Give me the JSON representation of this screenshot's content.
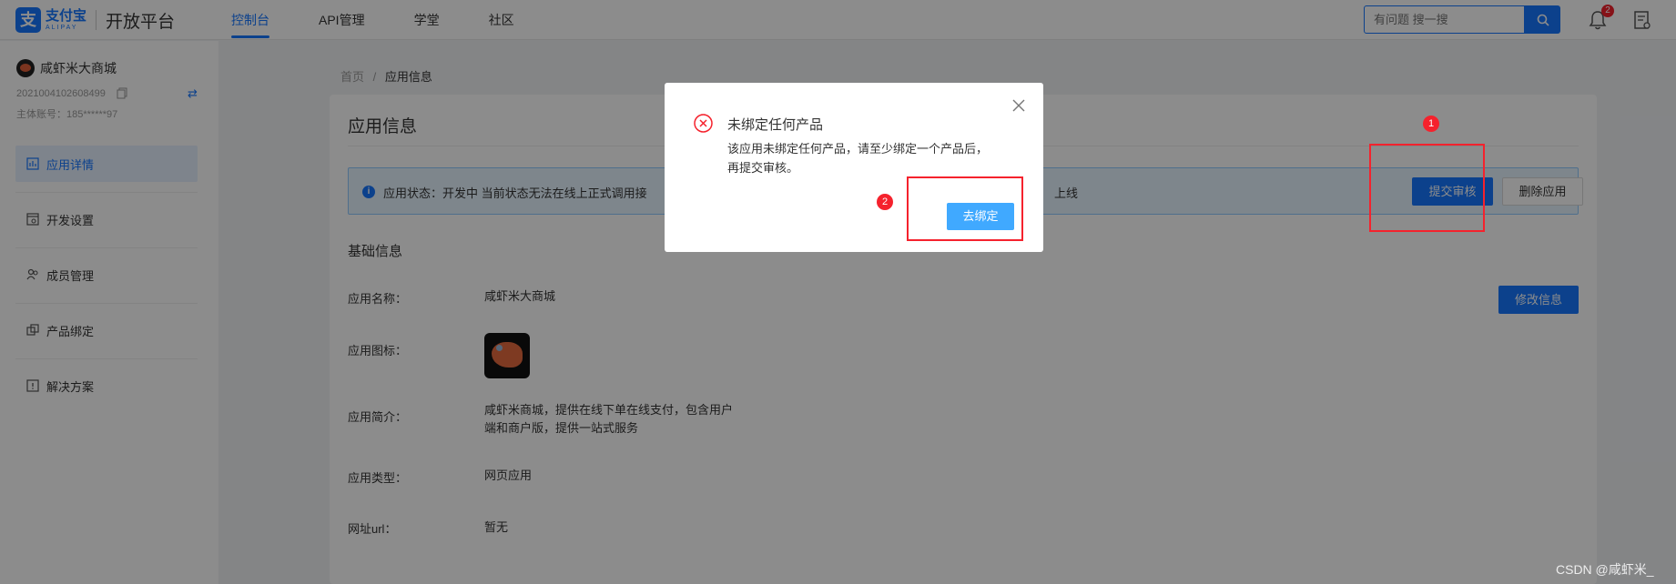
{
  "header": {
    "logo_cn": "支付宝",
    "logo_en": "ALIPAY",
    "platform": "开放平台",
    "nav": [
      "控制台",
      "API管理",
      "学堂",
      "社区"
    ],
    "search_placeholder": "有问题 搜一搜",
    "notification_count": "2"
  },
  "sidebar": {
    "app_name": "咸虾米大商城",
    "app_id": "2021004102608499",
    "account": "主体账号：185******97",
    "items": [
      {
        "label": "应用详情",
        "active": true
      },
      {
        "label": "开发设置"
      },
      {
        "label": "成员管理"
      },
      {
        "label": "产品绑定"
      },
      {
        "label": "解决方案"
      }
    ]
  },
  "breadcrumb": {
    "home": "首页",
    "sep": "/",
    "current": "应用信息"
  },
  "main": {
    "title": "应用信息",
    "alert": "应用状态：开发中 当前状态无法在线上正式调用接",
    "alert_tail": "上线",
    "submit_label": "提交审核",
    "delete_label": "删除应用",
    "section_title": "基础信息",
    "edit_label": "修改信息",
    "rows": [
      {
        "label": "应用名称：",
        "value": "咸虾米大商城"
      },
      {
        "label": "应用图标：",
        "value": ""
      },
      {
        "label": "应用简介：",
        "value_line1": "咸虾米商城，提供在线下单在线支付，包含用户",
        "value_line2": "端和商户版，提供一站式服务"
      },
      {
        "label": "应用类型：",
        "value": "网页应用"
      },
      {
        "label": "网址url：",
        "value": "暂无"
      }
    ]
  },
  "modal": {
    "title": "未绑定任何产品",
    "body_line1": "该应用未绑定任何产品，请至少绑定一个产品后，",
    "body_line2": "再提交审核。",
    "button": "去绑定"
  },
  "annotations": [
    "1",
    "2"
  ],
  "watermark": "CSDN @咸虾米_",
  "colors": {
    "accent": "#1677ff",
    "annotation": "#f5222d",
    "error": "#f5222d"
  }
}
